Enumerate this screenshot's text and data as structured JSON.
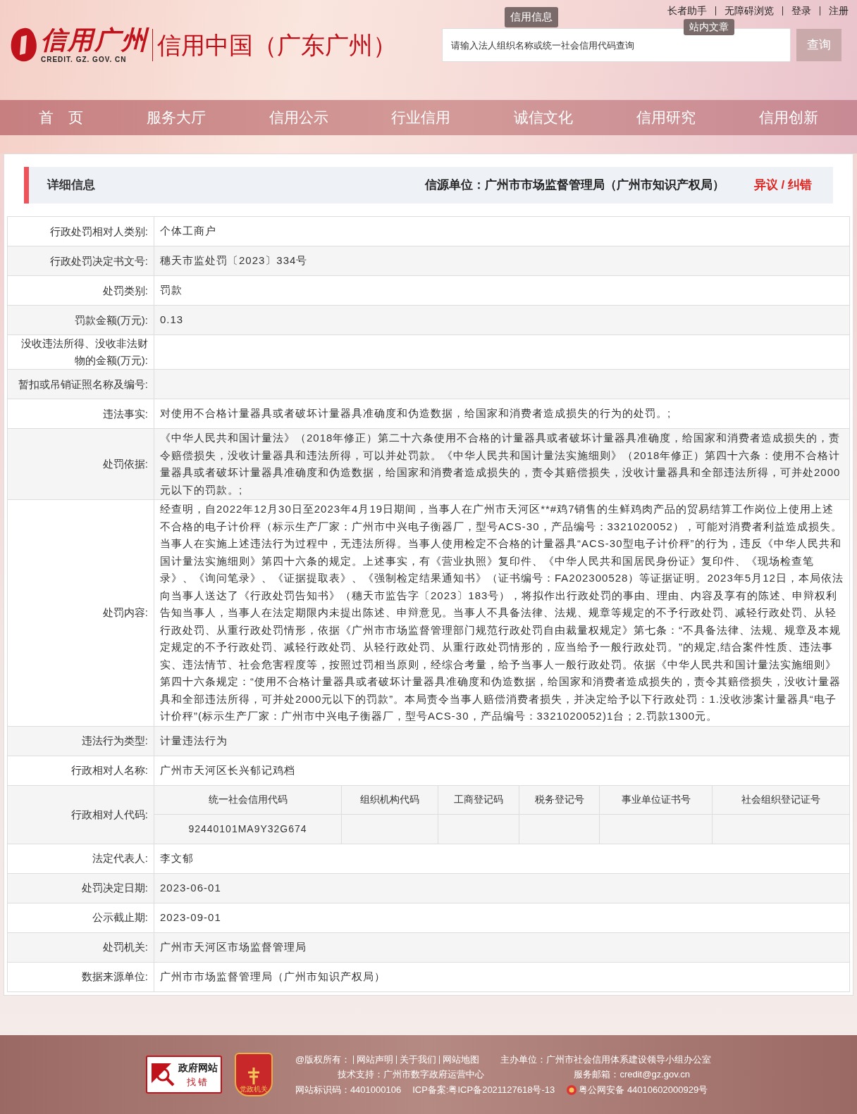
{
  "header": {
    "logo_text": "信用广州",
    "logo_sub": "CREDIT. GZ. GOV. CN",
    "site_title": "信用中国（广东广州）",
    "top_links": [
      "长者助手",
      "无障碍浏览",
      "登录",
      "注册"
    ],
    "tooltips": [
      "信用信息",
      "站内文章"
    ],
    "search": {
      "placeholder": "请输入法人组织名称或统一社会信用代码查询",
      "button": "查询"
    },
    "nav": [
      "首　页",
      "服务大厅",
      "信用公示",
      "行业信用",
      "诚信文化",
      "信用研究",
      "信用创新"
    ]
  },
  "detail": {
    "title": "详细信息",
    "source": "信源单位：广州市市场监督管理局（广州市知识产权局）",
    "dispute_link": "异议 / 纠错"
  },
  "rows": [
    {
      "kind": "text",
      "label": "行政处罚相对人类别:",
      "value": "个体工商户"
    },
    {
      "kind": "text",
      "label": "行政处罚决定书文号:",
      "value": "穗天市监处罚〔2023〕334号"
    },
    {
      "kind": "text",
      "label": "处罚类别:",
      "value": "罚款"
    },
    {
      "kind": "text",
      "label": "罚款金额(万元):",
      "value": "0.13"
    },
    {
      "kind": "text",
      "label": "没收违法所得、没收非法财物的金额(万元):"
    },
    {
      "kind": "text",
      "label": "暂扣或吊销证照名称及编号:"
    },
    {
      "kind": "text",
      "label": "违法事实:",
      "value": "对使用不合格计量器具或者破坏计量器具准确度和伪造数据，给国家和消费者造成损失的行为的处罚。;"
    },
    {
      "kind": "text",
      "label": "处罚依据:",
      "value": "《中华人民共和国计量法》（2018年修正）第二十六条使用不合格的计量器具或者破坏计量器具准确度，给国家和消费者造成损失的，责令赔偿损失，没收计量器具和违法所得，可以并处罚款。《中华人民共和国计量法实施细则》（2018年修正）第四十六条：使用不合格计量器具或者破坏计量器具准确度和伪造数据，给国家和消费者造成损失的，责令其赔偿损失，没收计量器具和全部违法所得，可并处2000元以下的罚款。;"
    },
    {
      "kind": "text",
      "label": "处罚内容:",
      "value": "经查明，自2022年12月30日至2023年4月19日期间，当事人在广州市天河区**#鸡7销售的生鲜鸡肉产品的贸易结算工作岗位上使用上述不合格的电子计价秤（标示生产厂家：广州市中兴电子衡器厂，型号ACS-30，产品编号：3321020052），可能对消费者利益造成损失。当事人在实施上述违法行为过程中，无违法所得。当事人使用检定不合格的计量器具“ACS-30型电子计价秤”的行为，违反《中华人民共和国计量法实施细则》第四十六条的规定。上述事实，有《营业执照》复印件、《中华人民共和国居民身份证》复印件、《现场检查笔录》、《询问笔录》、《证据提取表》、《强制检定结果通知书》（证书编号：FA202300528）等证据证明。2023年5月12日，本局依法向当事人送达了《行政处罚告知书》（穗天市监告字〔2023〕183号），将拟作出行政处罚的事由、理由、内容及享有的陈述、申辩权利告知当事人，当事人在法定期限内未提出陈述、申辩意见。当事人不具备法律、法规、规章等规定的不予行政处罚、减轻行政处罚、从轻行政处罚、从重行政处罚情形，依据《广州市市场监督管理部门规范行政处罚自由裁量权规定》第七条：“不具备法律、法规、规章及本规定规定的不予行政处罚、减轻行政处罚、从轻行政处罚、从重行政处罚情形的，应当给予一般行政处罚。”的规定,结合案件性质、违法事实、违法情节、社会危害程度等，按照过罚相当原则，经综合考量，给予当事人一般行政处罚。依据《中华人民共和国计量法实施细则》第四十六条规定：“使用不合格计量器具或者破坏计量器具准确度和伪造数据，给国家和消费者造成损失的，责令其赔偿损失，没收计量器具和全部违法所得，可并处2000元以下的罚款”。本局责令当事人赔偿消费者损失，并决定给予以下行政处罚：1.没收涉案计量器具“电子计价秤”(标示生产厂家：广州市中兴电子衡器厂，型号ACS-30，产品编号：3321020052)1台；2.罚款1300元。"
    },
    {
      "kind": "text",
      "label": "违法行为类型:",
      "value": "计量违法行为"
    },
    {
      "kind": "text",
      "label": "行政相对人名称:",
      "value": "广州市天河区长兴郁记鸡档"
    },
    {
      "kind": "codes",
      "label": "行政相对人代码:",
      "columns": [
        "统一社会信用代码",
        "组织机构代码",
        "工商登记码",
        "税务登记号",
        "事业单位证书号",
        "社会组织登记证号"
      ],
      "values": [
        "92440101MA9Y32G674"
      ]
    },
    {
      "kind": "text",
      "label": "法定代表人:",
      "value": "李文郁"
    },
    {
      "kind": "text",
      "label": "处罚决定日期:",
      "value": "2023-06-01"
    },
    {
      "kind": "text",
      "label": "公示截止期:",
      "value": "2023-09-01"
    },
    {
      "kind": "text",
      "label": "处罚机关:",
      "value": "广州市天河区市场监督管理局"
    },
    {
      "kind": "text",
      "label": "数据来源单位:",
      "value": "广州市市场监督管理局（广州市知识产权局）"
    }
  ],
  "footer": {
    "badge_top": "政府网站",
    "badge_bottom": "找错",
    "party_badge": "党政机关",
    "links": [
      "@版权所有：",
      "网站声明",
      "关于我们",
      "网站地图"
    ],
    "host": "主办单位：广州市社会信用体系建设领导小组办公室",
    "support": "技术支持：广州市数字政府运营中心",
    "email": "服务邮箱：credit@gz.gov.cn",
    "site_id": "网站标识码：4401000106",
    "icp": "ICP备案:粤ICP备2021127618号-13",
    "police": "粤公网安备 44010602000929号"
  }
}
